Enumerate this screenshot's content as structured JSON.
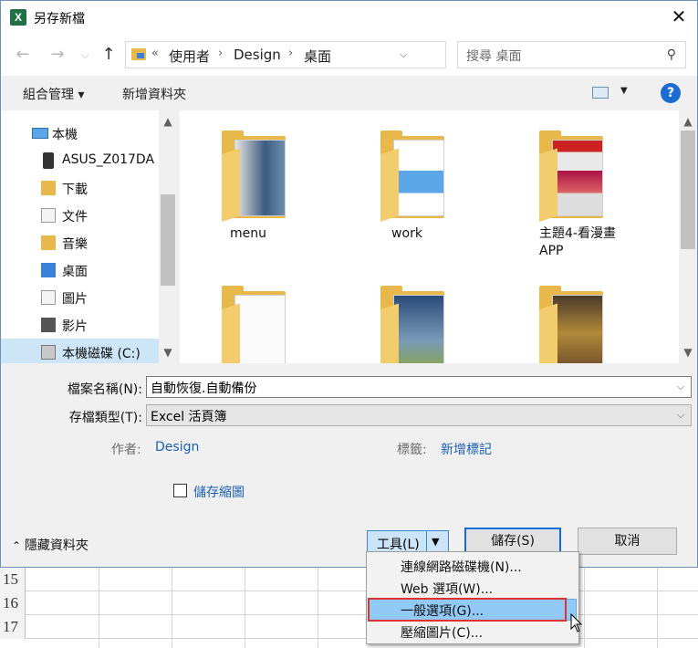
{
  "window": {
    "title": "另存新檔",
    "app_icon": "excel-icon",
    "close_glyph": "✕"
  },
  "nav": {
    "back": "←",
    "forward": "→",
    "recent": "⌵",
    "up": "↑",
    "breadcrumb": [
      "«",
      "使用者",
      "Design",
      "桌面"
    ],
    "refresh": "↻",
    "search_placeholder": "搜尋 桌面"
  },
  "toolbar": {
    "organize": "組合管理 ▾",
    "new_folder": "新增資料夾",
    "help": "?"
  },
  "sidebar": {
    "items": [
      {
        "label": "本機",
        "icon": "computer-icon"
      },
      {
        "label": "ASUS_Z017DA",
        "icon": "phone-icon"
      },
      {
        "label": "下載",
        "icon": "download-folder-icon"
      },
      {
        "label": "文件",
        "icon": "documents-folder-icon"
      },
      {
        "label": "音樂",
        "icon": "music-folder-icon"
      },
      {
        "label": "桌面",
        "icon": "desktop-folder-icon"
      },
      {
        "label": "圖片",
        "icon": "pictures-folder-icon"
      },
      {
        "label": "影片",
        "icon": "videos-folder-icon"
      },
      {
        "label": "本機磁碟 (C:)",
        "icon": "drive-icon"
      }
    ]
  },
  "files": [
    {
      "name": "menu"
    },
    {
      "name": "work"
    },
    {
      "name": "主題4-看漫畫\nAPP"
    },
    {
      "name": ""
    },
    {
      "name": ""
    },
    {
      "name": ""
    }
  ],
  "form": {
    "filename_label": "檔案名稱(N):",
    "filename_value": "自動恢復.自動備份",
    "filetype_label": "存檔類型(T):",
    "filetype_value": "Excel 活頁簿",
    "author_label": "作者:",
    "author_value": "Design",
    "tags_label": "標籤:",
    "tags_value": "新增標記",
    "thumbnail_label": "儲存縮圖"
  },
  "footer": {
    "hide_folders": "隱藏資料夾",
    "tools": "工具(L)",
    "save": "儲存(S)",
    "cancel": "取消"
  },
  "tools_menu": {
    "items": [
      "連線網路磁碟機(N)...",
      "Web 選項(W)...",
      "一般選項(G)...",
      "壓縮圖片(C)..."
    ],
    "highlighted_index": 2
  },
  "sheet": {
    "row_numbers": [
      "15",
      "16",
      "17"
    ]
  },
  "colors": {
    "accent": "#0a6fd8",
    "highlight": "#91c9f7",
    "annotation": "#e0302f",
    "folder": "#e8b84a"
  }
}
